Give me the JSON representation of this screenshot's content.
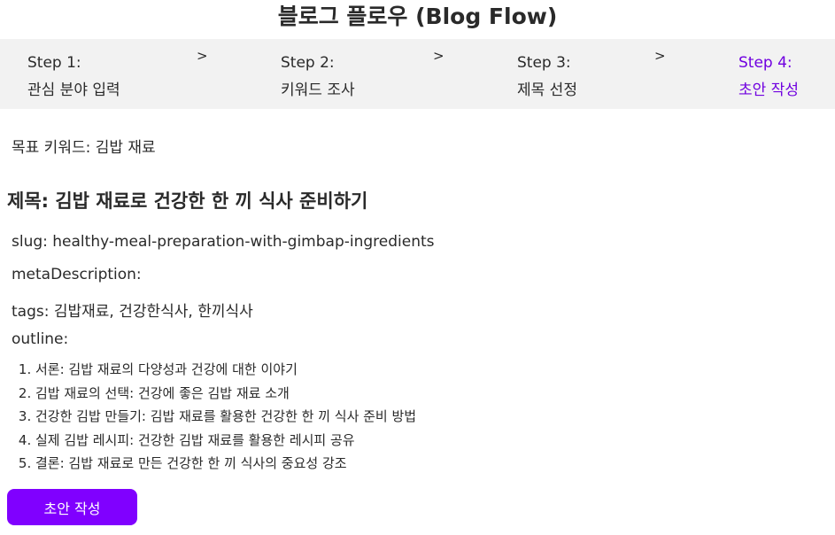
{
  "app": {
    "title": "블로그 플로우 (Blog Flow)"
  },
  "colors": {
    "accent": "#7000e0",
    "button": "#8000ff",
    "stepper_bg": "#f2f2f2"
  },
  "steps": [
    {
      "label": "Step 1:",
      "name": "관심 분야 입력",
      "active": false
    },
    {
      "label": "Step 2:",
      "name": "키워드 조사",
      "active": false
    },
    {
      "label": "Step 3:",
      "name": "제목 선정",
      "active": false
    },
    {
      "label": "Step 4:",
      "name": "초안 작성",
      "active": true
    }
  ],
  "separator": ">",
  "keyword": {
    "text": "목표 키워드: 김밥 재료"
  },
  "post": {
    "title": "제목: 김밥 재료로 건강한 한 끼 식사 준비하기",
    "slug": "slug: healthy-meal-preparation-with-gimbap-ingredients",
    "meta_description": "metaDescription:",
    "tags": "tags: 김밥재료, 건강한식사, 한끼식사",
    "outline_label": "outline:",
    "outline": [
      "서론: 김밥 재료의 다양성과 건강에 대한 이야기",
      "김밥 재료의 선택: 건강에 좋은 김밥 재료 소개",
      "건강한 김밥 만들기: 김밥 재료를 활용한 건강한 한 끼 식사 준비 방법",
      "실제 김밥 레시피: 건강한 김밥 재료를 활용한 레시피 공유",
      "결론: 김밥 재료로 만든 건강한 한 끼 식사의 중요성 강조"
    ]
  },
  "actions": {
    "draft_button": "초안 작성"
  }
}
